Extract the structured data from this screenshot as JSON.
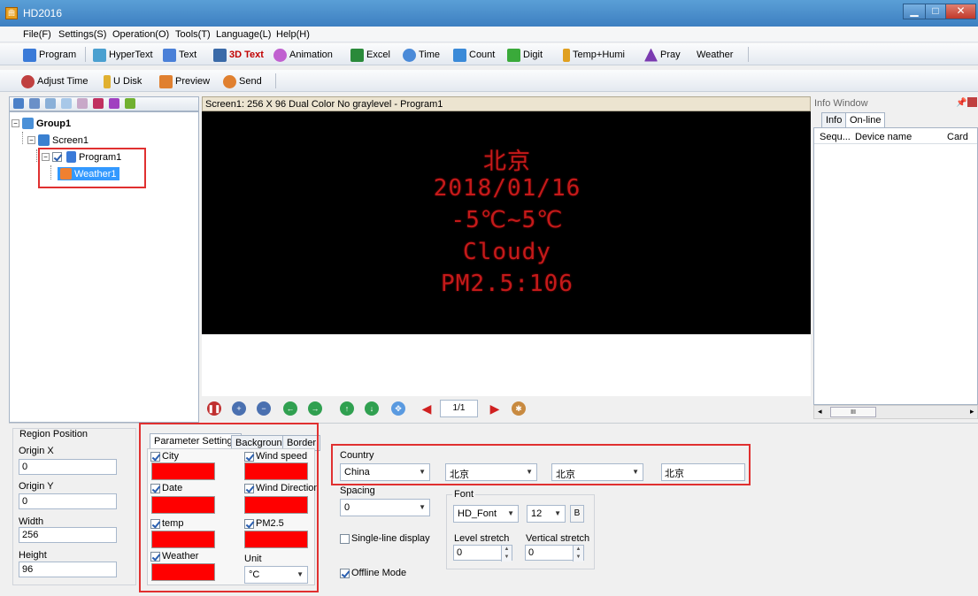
{
  "window": {
    "title": "HD2016",
    "icon": "app-icon"
  },
  "menu": [
    "File(F)",
    "Settings(S)",
    "Operation(O)",
    "Tools(T)",
    "Language(L)",
    "Help(H)"
  ],
  "toolbar1": [
    {
      "label": "Program",
      "icon": "program-icon",
      "color": "#3a7ad8"
    },
    {
      "label": "HyperText",
      "icon": "hypertext-icon",
      "color": "#4aa0d0"
    },
    {
      "label": "Text",
      "icon": "text-icon",
      "color": "#4a80d8"
    },
    {
      "label": "3D Text",
      "icon": "3d-text-icon",
      "color": "#3a6aa8"
    },
    {
      "label": "Animation",
      "icon": "animation-icon",
      "color": "#c060d0"
    },
    {
      "label": "Excel",
      "icon": "excel-icon",
      "color": "#2a8a3a"
    },
    {
      "label": "Time",
      "icon": "time-icon",
      "color": "#4a8ad8"
    },
    {
      "label": "Count",
      "icon": "count-icon",
      "color": "#3a8ad8"
    },
    {
      "label": "Digit",
      "icon": "digit-icon",
      "color": "#3aaa3a"
    },
    {
      "label": "Temp+Humi",
      "icon": "temp-humi-icon",
      "color": "#e0a020"
    },
    {
      "label": "Pray",
      "icon": "pray-icon",
      "color": "#7a3ab0"
    },
    {
      "label": "Weather",
      "icon": "",
      "color": ""
    }
  ],
  "toolbar2": [
    {
      "label": "Adjust Time",
      "icon": "adjust-time-icon",
      "color": "#c04040"
    },
    {
      "label": "U Disk",
      "icon": "usb-disk-icon",
      "color": "#e0b030"
    },
    {
      "label": "Preview",
      "icon": "preview-icon",
      "color": "#e08030"
    },
    {
      "label": "Send",
      "icon": "send-icon",
      "color": "#e08030"
    }
  ],
  "tree": {
    "group": "Group1",
    "screen": "Screen1",
    "program": "Program1",
    "weather": "Weather1"
  },
  "preview": {
    "header": "Screen1: 256 X 96  Dual Color No graylevel - Program1",
    "led_lines": [
      "北京",
      "2018/01/16",
      "-5℃~5℃",
      "Cloudy",
      "PM2.5:106"
    ],
    "led_color": "#c41a1a",
    "page": "1/1"
  },
  "info_window": {
    "title": "Info Window",
    "tabs": [
      "Info",
      "On-line"
    ],
    "columns": [
      "Sequ...",
      "Device name",
      "Card"
    ],
    "scroll": "III"
  },
  "region": {
    "title": "Region Position",
    "origin_x_label": "Origin X",
    "origin_x": "0",
    "origin_y_label": "Origin Y",
    "origin_y": "0",
    "width_label": "Width",
    "width": "256",
    "height_label": "Height",
    "height": "96"
  },
  "params": {
    "tabs": [
      "Parameter Settings",
      "Background",
      "Border"
    ],
    "left": [
      {
        "label": "City",
        "checked": true
      },
      {
        "label": "Date",
        "checked": true
      },
      {
        "label": "temp",
        "checked": true
      },
      {
        "label": "Weather",
        "checked": true
      }
    ],
    "right": [
      {
        "label": "Wind speed",
        "checked": true
      },
      {
        "label": "Wind Direction",
        "checked": true
      },
      {
        "label": "PM2.5",
        "checked": true
      }
    ],
    "unit_label": "Unit",
    "unit_value": "°C",
    "swatch_color": "#ff0000"
  },
  "country": {
    "label": "Country",
    "country_value": "China",
    "province_value": "北京",
    "city_value": "北京",
    "city_text": "北京"
  },
  "spacing": {
    "label": "Spacing",
    "value": "0"
  },
  "font": {
    "label": "Font",
    "family": "HD_Font",
    "size": "12",
    "bold": "B",
    "level_label": "Level stretch",
    "level_value": "0",
    "vertical_label": "Vertical stretch",
    "vertical_value": "0"
  },
  "single_line": {
    "label": "Single-line display",
    "checked": false
  },
  "offline": {
    "label": "Offline Mode",
    "checked": true
  }
}
